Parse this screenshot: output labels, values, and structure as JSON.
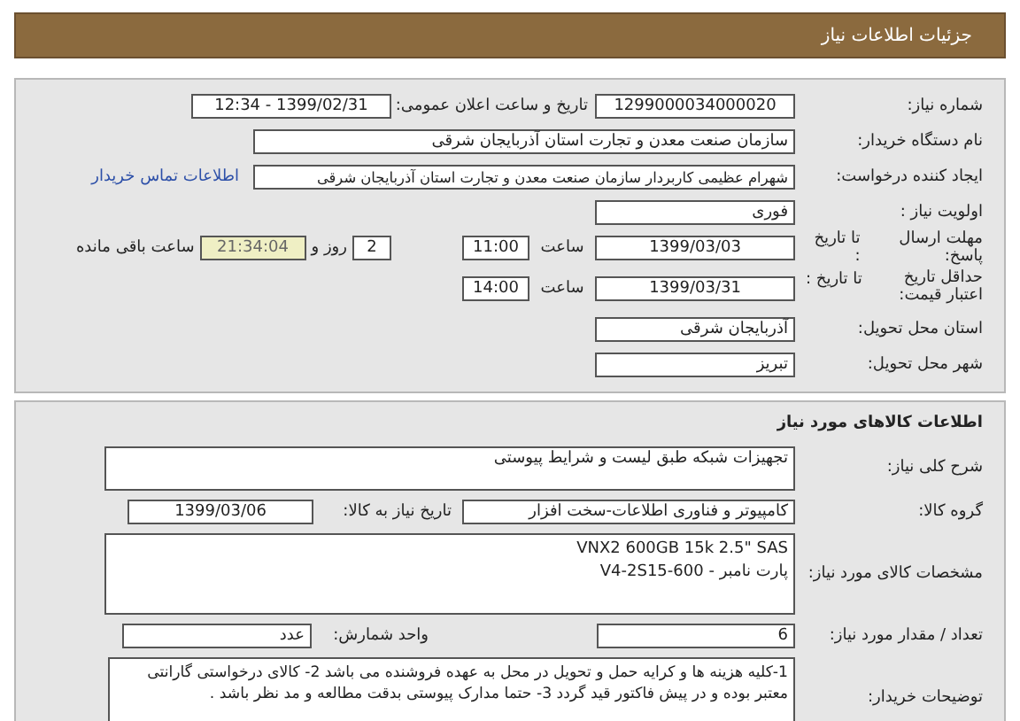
{
  "header": {
    "title": "جزئیات اطلاعات نیاز"
  },
  "need_number": {
    "label": "شماره نیاز:",
    "value": "1299000034000020"
  },
  "announce": {
    "label": "تاریخ و ساعت اعلان عمومی:",
    "value": "1399/02/31 - 12:34"
  },
  "buyer_org": {
    "label": "نام دستگاه خریدار:",
    "value": "سازمان صنعت معدن و تجارت استان آذربایجان شرقی"
  },
  "creator": {
    "label": "ایجاد کننده درخواست:",
    "value": "شهرام عظیمی کاربردار سازمان صنعت معدن و تجارت استان آذربایجان شرقی",
    "link": "اطلاعات تماس خریدار"
  },
  "priority": {
    "label": "اولویت نیاز :",
    "value": "فوری"
  },
  "reply_deadline": {
    "label": "مهلت ارسال پاسخ:",
    "sublabel": "تا تاریخ :",
    "date": "1399/03/03",
    "time_label": "ساعت",
    "time": "11:00",
    "days": "2",
    "days_suffix": "روز و",
    "remaining": "21:34:04",
    "remaining_label": "ساعت باقی مانده"
  },
  "price_validity": {
    "label": "حداقل تاریخ اعتبار قیمت:",
    "sublabel": "تا تاریخ :",
    "date": "1399/03/31",
    "time_label": "ساعت",
    "time": "14:00"
  },
  "province": {
    "label": "استان محل تحویل:",
    "value": "آذربایجان شرقی"
  },
  "city": {
    "label": "شهر محل تحویل:",
    "value": "تبریز"
  },
  "goods": {
    "title": "اطلاعات کالاهای مورد نیاز",
    "description": {
      "label": "شرح کلی نیاز:",
      "value": "تجهیزات شبکه طبق لیست و شرایط پیوستی"
    },
    "group": {
      "label": "گروه کالا:",
      "value": "کامپیوتر و فناوری اطلاعات-سخت افزار"
    },
    "need_date": {
      "label": "تاریخ نیاز به کالا:",
      "value": "1399/03/06"
    },
    "specs": {
      "label": "مشخصات کالای مورد نیاز:",
      "lines": [
        "VNX2 600GB 15k 2.5\" SAS",
        "پارت نامبر -  V4-2S15-600"
      ]
    },
    "quantity": {
      "label": "تعداد / مقدار مورد نیاز:",
      "value": "6"
    },
    "unit": {
      "label": "واحد شمارش:",
      "value": "عدد"
    },
    "notes": {
      "label": "توضیحات خریدار:",
      "value": "1-کلیه هزینه ها و کرایه حمل و تحویل در محل به عهده فروشنده می باشد 2- کالای درخواستی گارانتی معتبر بوده و در پیش فاکتور قید گردد 3- حتما مدارک پیوستی بدقت مطالعه و مد نظر باشد ."
    }
  }
}
